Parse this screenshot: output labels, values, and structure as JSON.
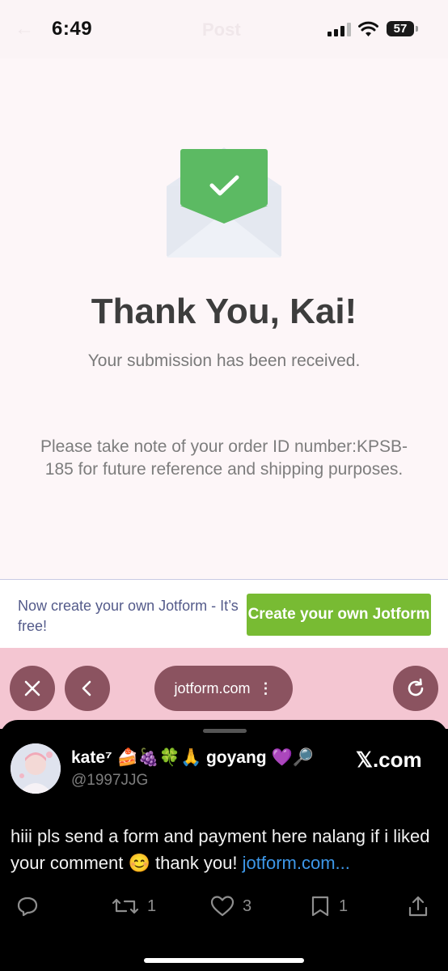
{
  "status_bar": {
    "time": "6:49",
    "faded_title": "Post",
    "battery": "57"
  },
  "form": {
    "title": "Thank You, Kai!",
    "subtitle": "Your submission has been received.",
    "order_note": "Please take note of your order ID number:KPSB-185 for future reference and shipping purposes."
  },
  "promo": {
    "text": "Now create your own Jotform - It’s free!",
    "button_label": "Create your own Jotform"
  },
  "browser": {
    "url": "jotform.com",
    "icons": [
      "close-icon",
      "back-icon",
      "more-icon",
      "reload-icon"
    ]
  },
  "tweet": {
    "display_name": "kate⁷ 🍰🍇🍀🙏 goyang 💜🔎",
    "handle": "@1997JJG",
    "site_label": "𝕏.com",
    "text": "hiii pls send a form and payment here nalang if i liked your comment 😊 thank you! ",
    "link": "jotform.com...",
    "actions": [
      {
        "icon": "reply-icon",
        "count": ""
      },
      {
        "icon": "retweet-icon",
        "count": "1"
      },
      {
        "icon": "heart-icon",
        "count": "3"
      },
      {
        "icon": "bookmark-icon",
        "count": "1"
      },
      {
        "icon": "share-icon",
        "count": ""
      }
    ]
  },
  "colors": {
    "page_bg": "#fdf6f8",
    "check_green": "#5cba63",
    "promo_button": "#78bb33",
    "browser_bar": "#f4c6d2",
    "browser_button": "#8b5360",
    "link_blue": "#3d97e8"
  }
}
